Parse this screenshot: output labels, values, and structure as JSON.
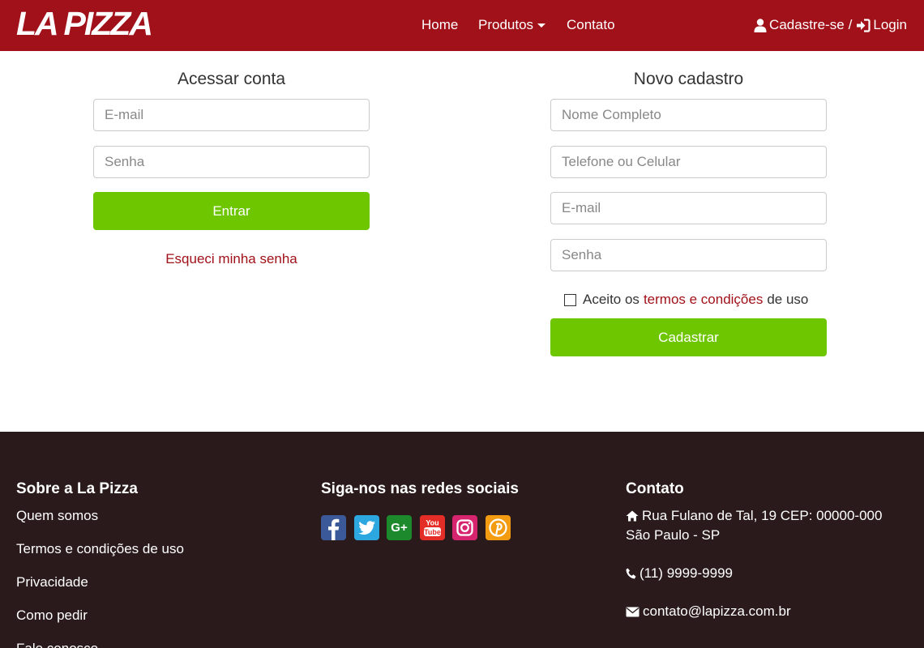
{
  "header": {
    "brand": "LA PIZZA",
    "nav": {
      "home": "Home",
      "produtos": "Produtos",
      "contato": "Contato"
    },
    "signup": "Cadastre-se",
    "separator": "/",
    "login": "Login"
  },
  "login_form": {
    "title": "Acessar conta",
    "email_placeholder": "E-mail",
    "password_placeholder": "Senha",
    "submit": "Entrar",
    "forgot": "Esqueci minha senha"
  },
  "register_form": {
    "title": "Novo cadastro",
    "name_placeholder": "Nome Completo",
    "phone_placeholder": "Telefone ou Celular",
    "email_placeholder": "E-mail",
    "password_placeholder": "Senha",
    "terms_prefix": "Aceito os",
    "terms_link": "termos e condições",
    "terms_suffix": "de uso",
    "submit": "Cadastrar"
  },
  "footer": {
    "about": {
      "title": "Sobre a La Pizza",
      "links": [
        "Quem somos",
        "Termos e condições de uso",
        "Privacidade",
        "Como pedir",
        "Fale conosco"
      ]
    },
    "social": {
      "title": "Siga-nos nas redes sociais",
      "networks": [
        "facebook-icon",
        "twitter-icon",
        "google-plus-icon",
        "youtube-icon",
        "instagram-icon",
        "pinterest-icon"
      ]
    },
    "contact": {
      "title": "Contato",
      "address_line1": "Rua Fulano de Tal, 19 CEP: 00000-000",
      "address_line2": "São Paulo - SP",
      "phone": "(11) 9999-9999",
      "email": "contato@lapizza.com.br"
    }
  },
  "colors": {
    "brand_red": "#a01119",
    "button_green": "#6ec600",
    "footer_bg": "#2a1a1b"
  }
}
